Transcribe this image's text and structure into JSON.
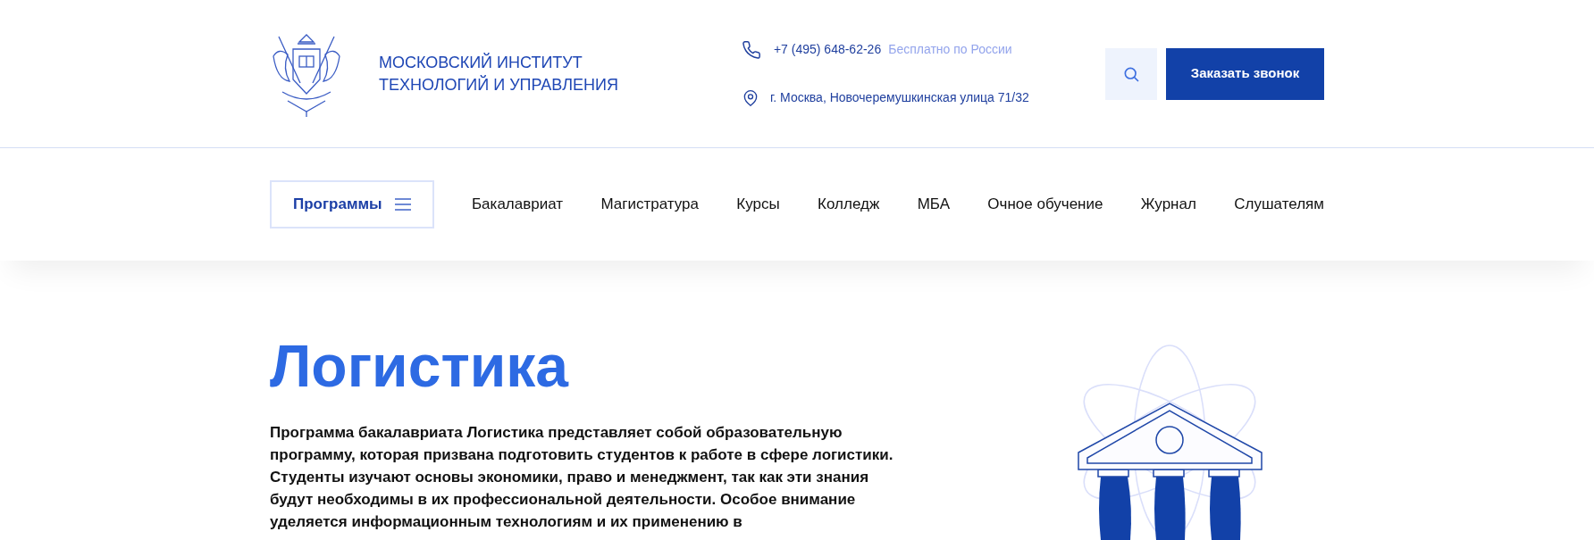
{
  "header": {
    "logo_lines": [
      "МОСКОВСКИЙ ИНСТИТУТ",
      "ТЕХНОЛОГИЙ И УПРАВЛЕНИЯ"
    ],
    "phone": "+7 (495) 648-62-26",
    "phone_note": "Бесплатно по России",
    "address": "г. Москва, Новочеремушкинская улица 71/32",
    "callback_button": "Заказать звонок"
  },
  "nav": {
    "programs_button": "Программы",
    "items": [
      "Бакалавриат",
      "Магистратура",
      "Курсы",
      "Колледж",
      "МБА",
      "Очное обучение",
      "Журнал",
      "Слушателям"
    ]
  },
  "hero": {
    "title": "Логистика",
    "description": "Программа бакалавриата Логистика представляет собой образовательную программу, которая призвана подготовить студентов к работе в сфере логистики. Студенты изучают основы экономики, право и менеджмент, так как эти знания будут необходимы в их профессиональной деятельности. Особое внимание уделяется информационным технологиям и их применению в"
  }
}
